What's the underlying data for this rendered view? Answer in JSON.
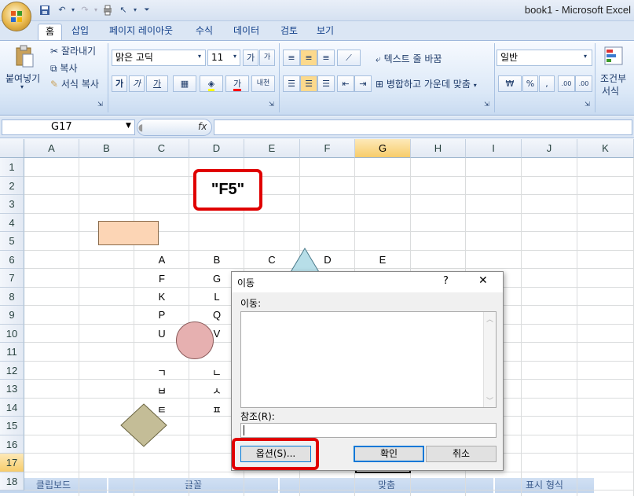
{
  "window": {
    "title": "book1 - Microsoft Excel"
  },
  "tabs": [
    {
      "label": "홈",
      "active": true
    },
    {
      "label": "삽입"
    },
    {
      "label": "페이지 레이아웃"
    },
    {
      "label": "수식"
    },
    {
      "label": "데이터"
    },
    {
      "label": "검토"
    },
    {
      "label": "보기"
    }
  ],
  "ribbon": {
    "clipboard": {
      "paste": "붙여넣기",
      "cut": "잘라내기",
      "copy": "복사",
      "format_painter": "서식 복사",
      "group": "클립보드"
    },
    "font": {
      "name": "맑은 고딕",
      "size": "11",
      "bold": "가",
      "italic": "가",
      "underline": "가",
      "group": "글꼴",
      "grow": "가",
      "shrink": "가",
      "phonetic": "내천"
    },
    "alignment": {
      "wrap": "텍스트 줄 바꿈",
      "merge": "병합하고 가운데 맞춤",
      "group": "맞춤"
    },
    "number": {
      "format": "일반",
      "currency": "₩",
      "percent": "%",
      "comma": ",",
      "inc_decimal": ".00",
      "dec_decimal": ".00",
      "group": "표시 형식"
    },
    "styles": {
      "conditional_1": "조건부",
      "conditional_2": "서식"
    }
  },
  "formula_bar": {
    "name_box": "G17",
    "fx": "fx",
    "value": ""
  },
  "columns": [
    "A",
    "B",
    "C",
    "D",
    "E",
    "F",
    "G",
    "H",
    "I",
    "J",
    "K"
  ],
  "selected_column": "G",
  "rows": [
    "1",
    "2",
    "3",
    "4",
    "5",
    "6",
    "7",
    "8",
    "9",
    "10",
    "11",
    "12",
    "13",
    "14",
    "15",
    "16",
    "17",
    "18"
  ],
  "selected_row": "17",
  "cells": {
    "c6": "A",
    "d6": "B",
    "e6": "C",
    "f6": "D",
    "g6": "E",
    "c7": "F",
    "d7": "G",
    "c8": "K",
    "d8": "L",
    "c9": "P",
    "d9": "Q",
    "c10": "U",
    "d10": "V",
    "c12": "ㄱ",
    "d12": "ㄴ",
    "c13": "ㅂ",
    "d13": "ㅅ",
    "c14": "ㅌ",
    "d14": "ㅍ"
  },
  "callout": {
    "text": "\"F5\""
  },
  "dialog": {
    "title": "이동",
    "help": "?",
    "close": "✕",
    "goto_label": "이동:",
    "reference_label": "참조(R):",
    "reference_value": "",
    "options_button": "옵션(S)...",
    "ok_button": "확인",
    "cancel_button": "취소"
  },
  "colors": {
    "accent_red": "#e00000",
    "header_selected": "#f7cc6a",
    "rect_fill": "#fcd5b5",
    "circle_fill": "#e6b0b0",
    "diamond_fill": "#c4bd97",
    "triangle_fill": "#b7dee8"
  }
}
